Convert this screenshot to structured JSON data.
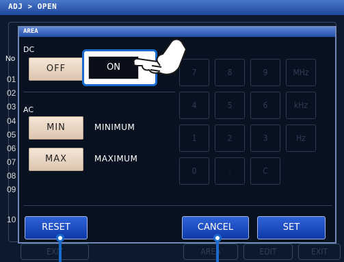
{
  "header": {
    "breadcrumb": "ADJ > OPEN"
  },
  "left_column": {
    "header": "No",
    "rows": [
      "01",
      "02",
      "03",
      "04",
      "05",
      "06",
      "07",
      "08",
      "09",
      "10"
    ]
  },
  "background_buttons": {
    "exit": "EXIT",
    "area": "AREA",
    "edit": "EDIT",
    "exit2": "EXIT"
  },
  "dialog": {
    "title": "AREA",
    "dc": {
      "label": "DC",
      "off": "OFF",
      "on": "ON"
    },
    "ac": {
      "label": "AC",
      "min": "MIN",
      "min_desc": "MINIMUM",
      "max": "MAX",
      "max_desc": "MAXIMUM"
    },
    "keypad": [
      "7",
      "8",
      "9",
      "MHz",
      "4",
      "5",
      "6",
      "kHz",
      "1",
      "2",
      "3",
      "Hz",
      "0",
      ".",
      "C"
    ],
    "buttons": {
      "reset": "RESET",
      "cancel": "CANCEL",
      "set": "SET"
    }
  },
  "colors": {
    "dialog_title": "#234ea8",
    "button_blue": "#1a4ec0",
    "callout": "#1a6ad0"
  }
}
